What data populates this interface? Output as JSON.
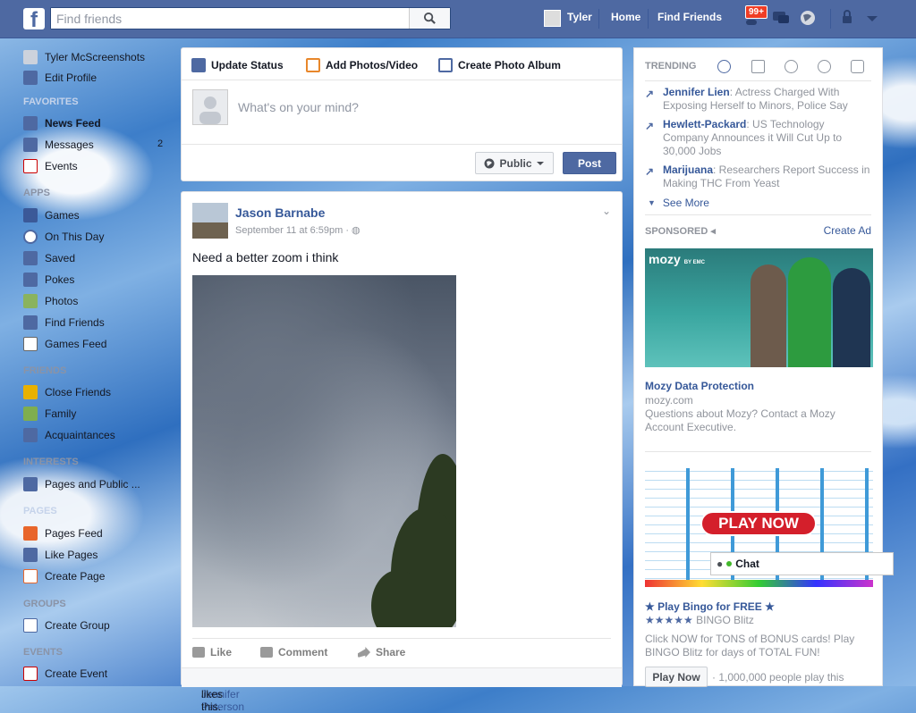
{
  "topbar": {
    "search_placeholder": "Find friends",
    "user_name": "Tyler",
    "home": "Home",
    "find_friends": "Find Friends",
    "notif_count": "99+"
  },
  "left_nav": {
    "profile_name": "Tyler McScreenshots",
    "edit_profile": "Edit Profile",
    "favorites_head": "FAVORITES",
    "favorites": [
      {
        "label": "News Feed"
      },
      {
        "label": "Messages",
        "count": "2"
      },
      {
        "label": "Events"
      }
    ],
    "apps_head": "APPS",
    "apps": [
      "Games",
      "On This Day",
      "Saved",
      "Pokes",
      "Photos",
      "Find Friends",
      "Games Feed"
    ],
    "friends_head": "FRIENDS",
    "friends": [
      "Close Friends",
      "Family",
      "Acquaintances"
    ],
    "interests_head": "INTERESTS",
    "interests": [
      "Pages and Public ..."
    ],
    "pages_head": "PAGES",
    "pages": [
      "Pages Feed",
      "Like Pages",
      "Create Page"
    ],
    "groups_head": "GROUPS",
    "groups": [
      "Create Group"
    ],
    "events_head": "EVENTS",
    "events": [
      "Create Event"
    ]
  },
  "composer": {
    "tab_status": "Update Status",
    "tab_photo": "Add Photos/Video",
    "tab_album": "Create Photo Album",
    "placeholder": "What's on your mind?",
    "audience": "Public",
    "post": "Post"
  },
  "story": {
    "author": "Jason Barnabe",
    "time": "September 11 at 6:59pm ·",
    "text": "Need a better zoom i think",
    "like": "Like",
    "comment": "Comment",
    "share": "Share",
    "likes_name": "Jennifer Paterson",
    "likes_suffix": " likes this."
  },
  "trending": {
    "head": "TRENDING",
    "items": [
      {
        "title": "Jennifer Lien",
        "desc": ": Actress Charged With Exposing Herself to Minors, Police Say"
      },
      {
        "title": "Hewlett-Packard",
        "desc": ": US Technology Company Announces it Will Cut Up to 30,000 Jobs"
      },
      {
        "title": "Marijuana",
        "desc": ": Researchers Report Success in Making THC From Yeast"
      }
    ],
    "see_more": "See More"
  },
  "sponsored": {
    "head": "SPONSORED",
    "create_ad": "Create Ad",
    "ad1": {
      "brand": "mozy",
      "brand_sub": "BY EMC",
      "title": "Mozy Data Protection",
      "domain": "mozy.com",
      "body": "Questions about Mozy? Contact a Mozy Account Executive."
    },
    "ad2": {
      "banner": "PLAY NOW",
      "title": "★ Play Bingo for FREE ★",
      "rating_stars": "★★★★★",
      "app_name": "BINGO Blitz",
      "body": "Click NOW for TONS of BONUS cards! Play BINGO Blitz for days of TOTAL FUN!",
      "cta": "Play Now",
      "social": "· 1,000,000 people play this"
    }
  },
  "chat": {
    "label": "Chat"
  },
  "colors": {
    "brand": "#4e69a2",
    "link": "#365899"
  }
}
